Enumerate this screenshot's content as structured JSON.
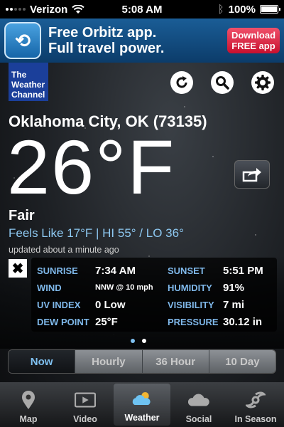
{
  "status_bar": {
    "carrier": "Verizon",
    "time": "5:08 AM",
    "battery_text": "100%",
    "battery_level": 1.0
  },
  "ad": {
    "line1": "Free Orbitz app.",
    "line2": "Full travel power.",
    "button_line1": "Download",
    "button_line2": "FREE app"
  },
  "brand": {
    "line1": "The",
    "line2": "Weather",
    "line3": "Channel"
  },
  "weather": {
    "location": "Oklahoma City, OK (73135)",
    "temperature": "26°F",
    "condition": "Fair",
    "feels_like": "Feels Like 17°F | HI 55° / LO 36°",
    "updated": "updated about a minute ago"
  },
  "details": {
    "sunrise_label": "SUNRISE",
    "sunrise_value": "7:34 AM",
    "sunset_label": "SUNSET",
    "sunset_value": "5:51 PM",
    "wind_label": "WIND",
    "wind_value": "NNW @ 10 mph",
    "humidity_label": "HUMIDITY",
    "humidity_value": "91%",
    "uv_label": "UV INDEX",
    "uv_value": "0 Low",
    "visibility_label": "VISIBILITY",
    "visibility_value": "7 mi",
    "dew_label": "DEW POINT",
    "dew_value": "25°F",
    "pressure_label": "PRESSURE",
    "pressure_value": "30.12 in"
  },
  "forecast_tabs": [
    "Now",
    "Hourly",
    "36 Hour",
    "10 Day"
  ],
  "tab_bar": [
    "Map",
    "Video",
    "Weather",
    "Social",
    "In Season"
  ],
  "icons": {
    "refresh": "refresh-icon",
    "search": "search-icon",
    "settings": "gear-icon",
    "share": "share-icon",
    "close": "close-icon"
  },
  "colors": {
    "accent_blue": "#7fc0f0",
    "label_blue": "#7fb8ea",
    "brand_blue": "#1b3f9a",
    "ad_red": "#c8102e"
  }
}
